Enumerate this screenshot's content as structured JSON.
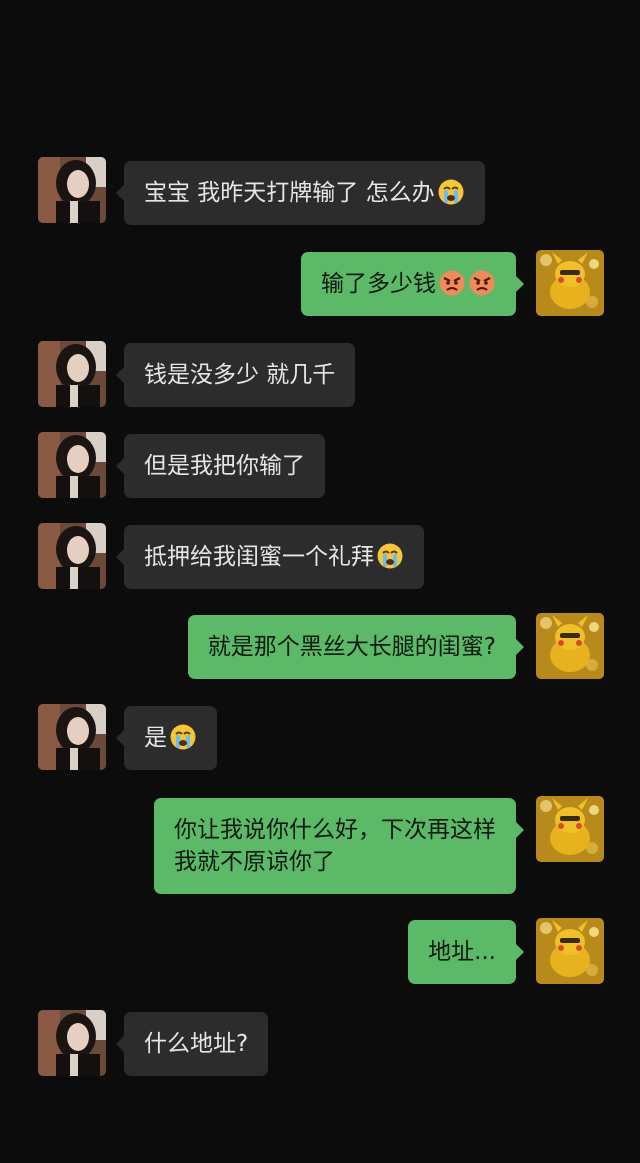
{
  "chat": {
    "messages": [
      {
        "side": "left",
        "text": "宝宝 我昨天打牌输了 怎么办",
        "emoji": [
          "crying-face-icon"
        ]
      },
      {
        "side": "right",
        "text": "输了多少钱",
        "emoji": [
          "angry-face-icon",
          "angry-face-icon"
        ]
      },
      {
        "side": "left",
        "text": "钱是没多少 就几千",
        "emoji": []
      },
      {
        "side": "left",
        "text": "但是我把你输了",
        "emoji": []
      },
      {
        "side": "left",
        "text": "抵押给我闺蜜一个礼拜",
        "emoji": [
          "crying-face-icon"
        ]
      },
      {
        "side": "right",
        "text": "就是那个黑丝大长腿的闺蜜?",
        "emoji": []
      },
      {
        "side": "left",
        "text": "是",
        "emoji": [
          "crying-face-icon"
        ]
      },
      {
        "side": "right",
        "text": "你让我说你什么好，下次再这样\n我就不原谅你了",
        "emoji": []
      },
      {
        "side": "right",
        "text": "地址...",
        "emoji": []
      },
      {
        "side": "left",
        "text": "什么地址?",
        "emoji": []
      }
    ]
  },
  "colors": {
    "background": "#0c0c0c",
    "left_bubble": "#2c2c2c",
    "right_bubble": "#5bb968"
  }
}
